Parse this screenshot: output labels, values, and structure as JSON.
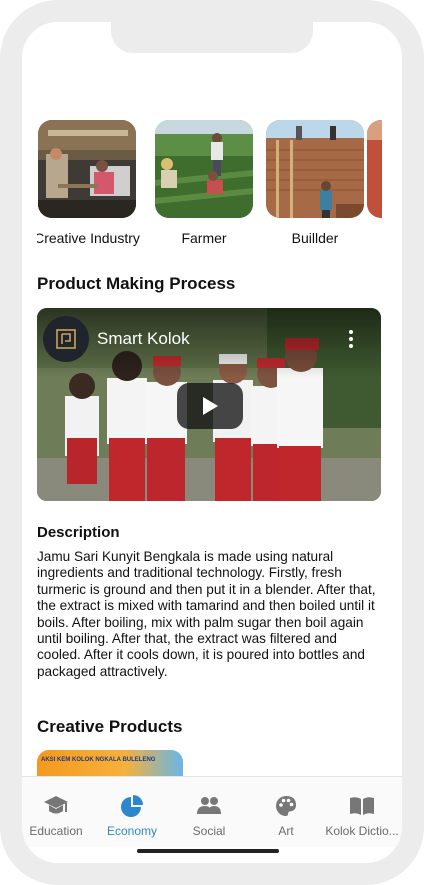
{
  "categories": [
    {
      "label": "Creative Industry",
      "image": "weaving-loom-photo"
    },
    {
      "label": "Farmer",
      "image": "farm-field-photo"
    },
    {
      "label": "Buillder",
      "image": "brick-building-photo"
    }
  ],
  "process": {
    "title": "Product Making Process",
    "video": {
      "channel": "Smart Kolok",
      "thumbnail": "schoolchildren-photo",
      "play_icon": "play-icon",
      "menu_icon": "more-vertical-icon"
    }
  },
  "description": {
    "title": "Description",
    "text": "Jamu Sari Kunyit Bengkala is made using natural ingredients and traditional technology. Firstly, fresh turmeric is ground and then put it in a blender. After that, the extract is mixed with tamarind and then boiled until it boils. After boiling, mix with palm sugar then boil again until boiling. After that, the extract was filtered and cooled. After it cools down, it is poured into bottles and packaged attractively."
  },
  "creative_products": {
    "title": "Creative Products",
    "card_text": "AKSI KEM KOLOK NGKALA BULELENG"
  },
  "bottom_nav": {
    "active_color": "#2c87cf",
    "items": [
      {
        "label": "Education",
        "icon": "graduation-cap-icon"
      },
      {
        "label": "Economy",
        "icon": "pie-chart-icon"
      },
      {
        "label": "Social",
        "icon": "people-icon"
      },
      {
        "label": "Art",
        "icon": "palette-icon"
      },
      {
        "label": "Kolok Dictio...",
        "icon": "book-icon"
      }
    ]
  }
}
